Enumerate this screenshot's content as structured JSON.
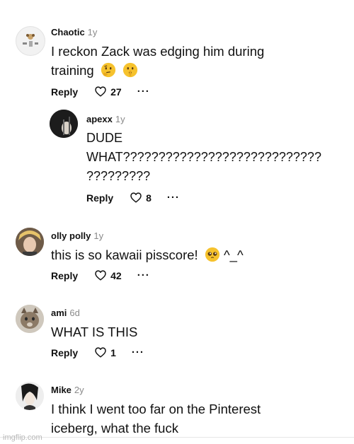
{
  "comments": [
    {
      "user": "Chaotic",
      "age": "1y",
      "line1": "I reckon Zack was edging him during",
      "line2": "training",
      "reply": "Reply",
      "likes": "27",
      "emojis": [
        "thinking-face",
        "shushing-face"
      ]
    },
    {
      "user": "apexx",
      "age": "1y",
      "line1": "DUDE",
      "line2": "WHAT????????????????????????????",
      "line3": "?????????",
      "reply": "Reply",
      "likes": "8"
    },
    {
      "user": "olly polly",
      "age": "1y",
      "line1": "this is so kawaii pisscore!",
      "line1_suffix": "^_^",
      "reply": "Reply",
      "likes": "42",
      "emojis": [
        "pleading-face"
      ]
    },
    {
      "user": "ami",
      "age": "6d",
      "line1": "WHAT IS THIS",
      "reply": "Reply",
      "likes": "1"
    },
    {
      "user": "Mike",
      "age": "2y",
      "line1": "I think I went too far on the Pinterest",
      "line2": "iceberg, what the fuck"
    }
  ],
  "watermark": "imgflip.com",
  "colors": {
    "text": "#111111",
    "muted": "#8a8a8a",
    "emoji": "#f6c22d"
  }
}
